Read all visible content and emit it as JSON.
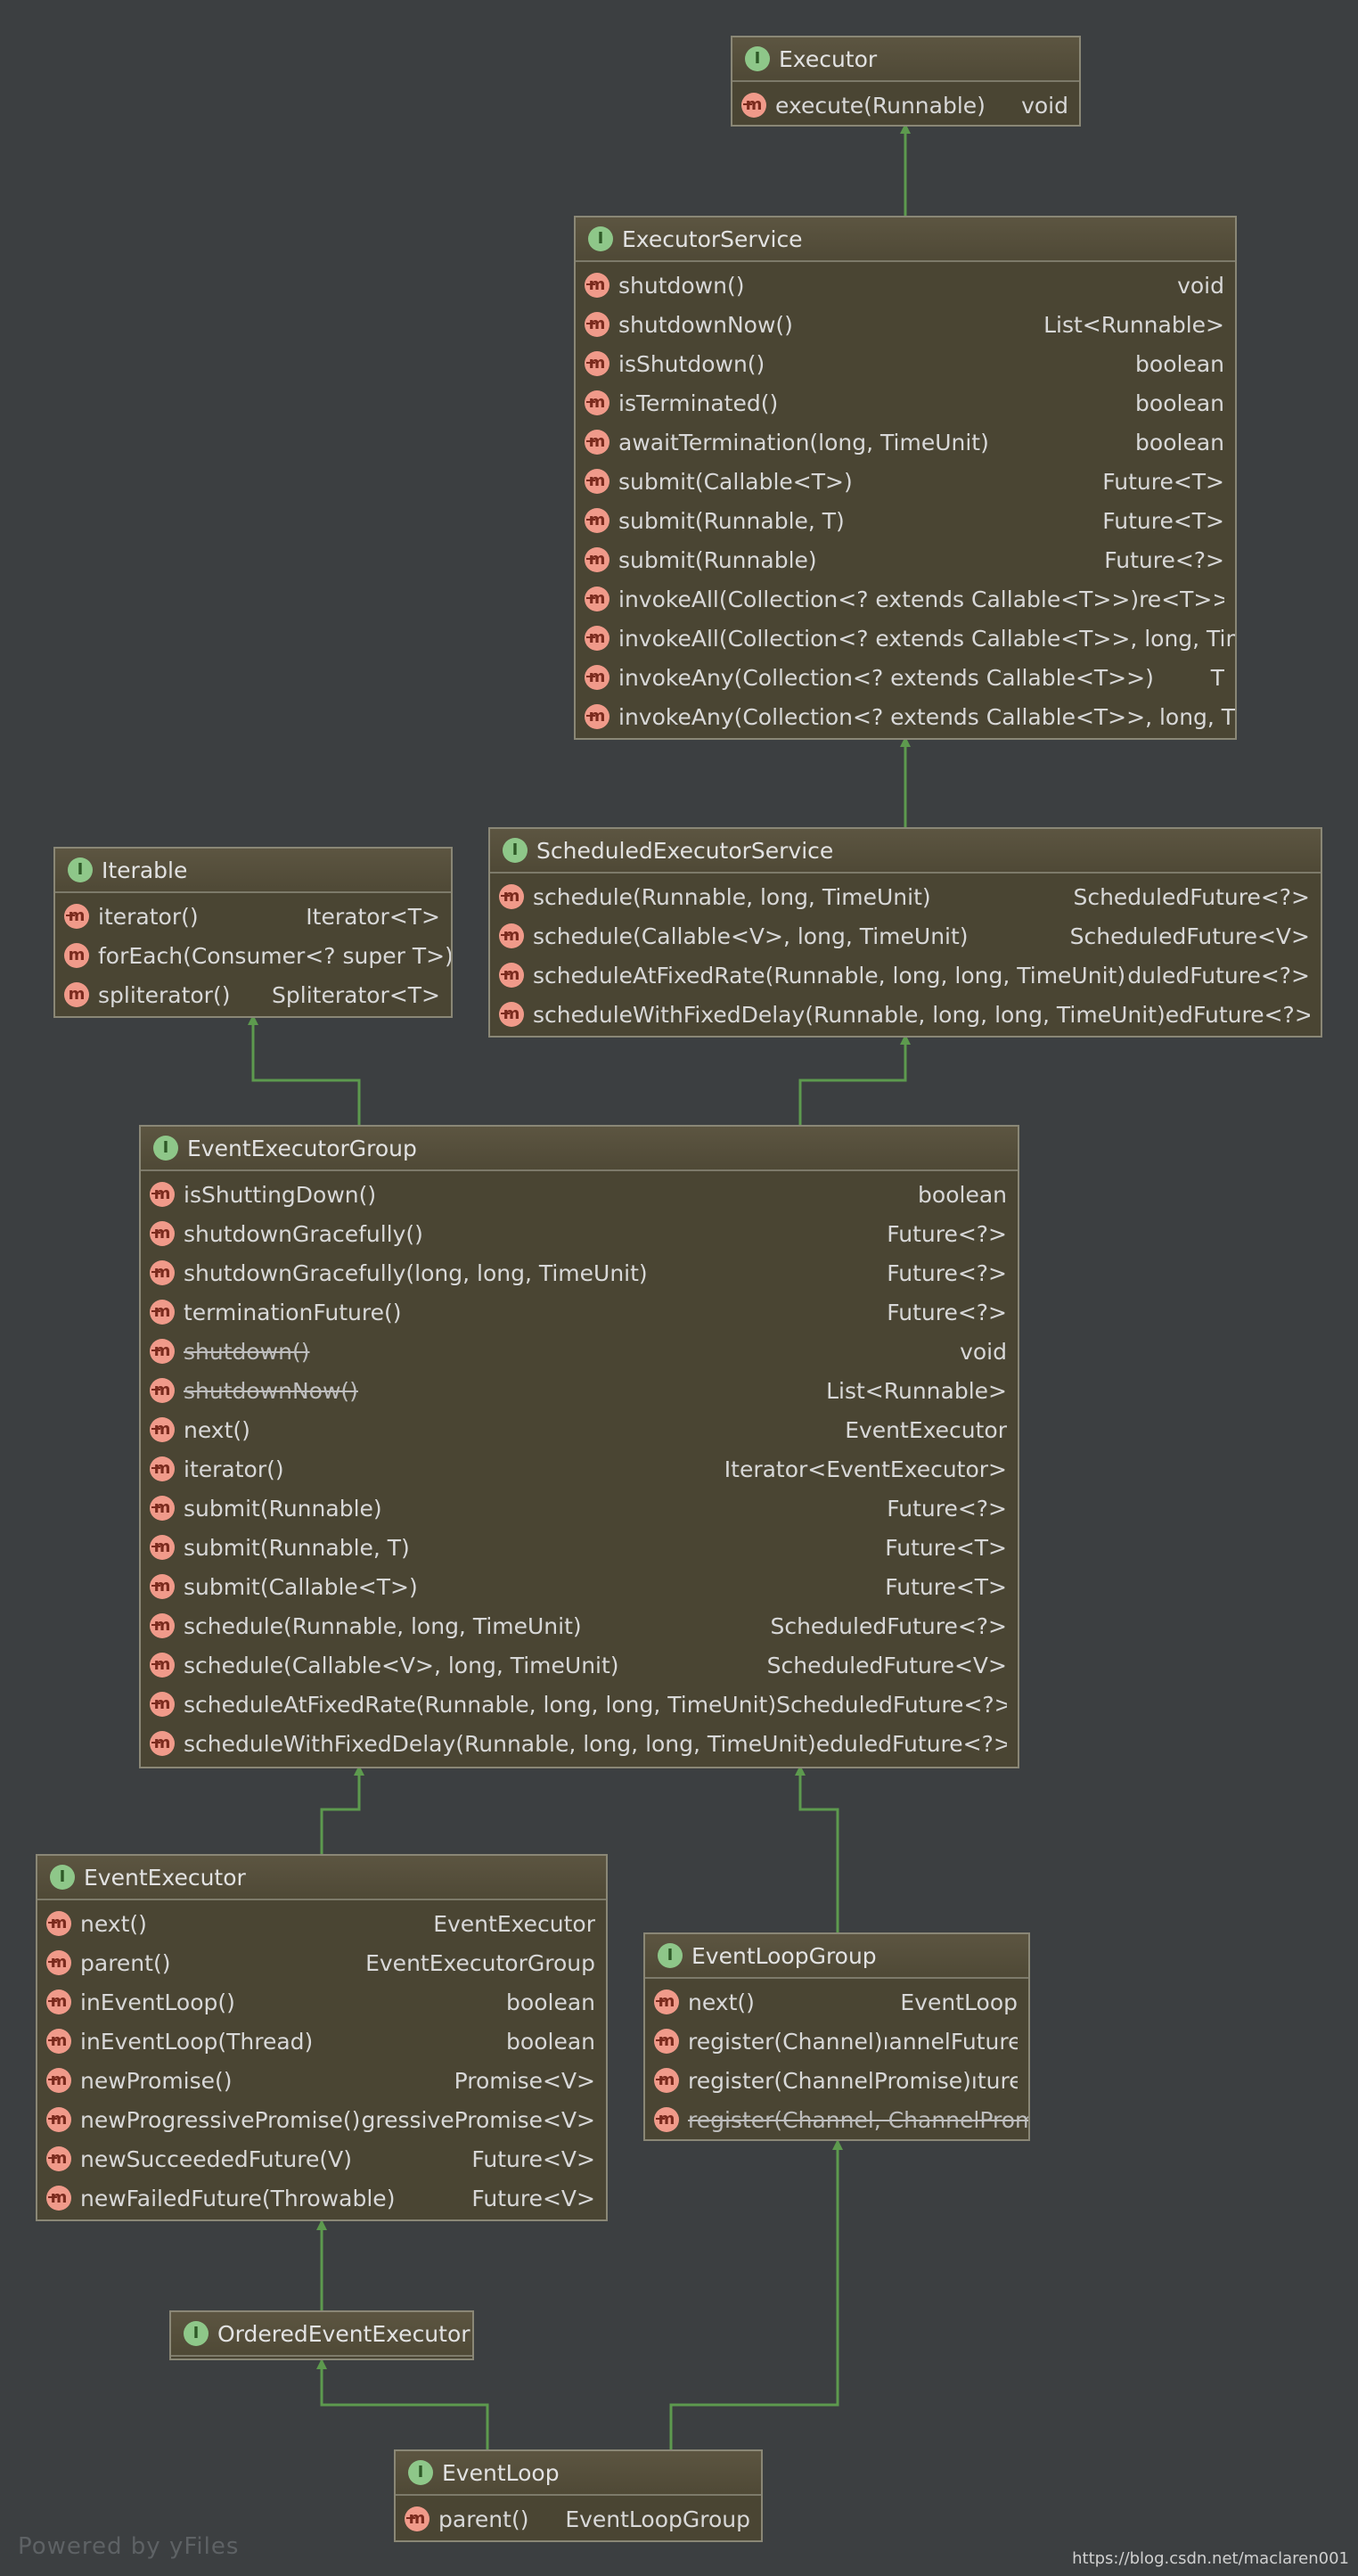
{
  "nodes": {
    "executor": {
      "title": "Executor",
      "methods": [
        {
          "name": "execute(Runnable)",
          "ret": "void",
          "abstract": true
        }
      ]
    },
    "executor_service": {
      "title": "ExecutorService",
      "methods": [
        {
          "name": "shutdown()",
          "ret": "void",
          "abstract": true
        },
        {
          "name": "shutdownNow()",
          "ret": "List<Runnable>",
          "abstract": true
        },
        {
          "name": "isShutdown()",
          "ret": "boolean",
          "abstract": true
        },
        {
          "name": "isTerminated()",
          "ret": "boolean",
          "abstract": true
        },
        {
          "name": "awaitTermination(long, TimeUnit)",
          "ret": "boolean",
          "abstract": true
        },
        {
          "name": "submit(Callable<T>)",
          "ret": "Future<T>",
          "abstract": true
        },
        {
          "name": "submit(Runnable, T)",
          "ret": "Future<T>",
          "abstract": true
        },
        {
          "name": "submit(Runnable)",
          "ret": "Future<?>",
          "abstract": true
        },
        {
          "name": "invokeAll(Collection<? extends Callable<T>>)",
          "ret": "re<T>>",
          "abstract": true
        },
        {
          "name": "invokeAll(Collection<? extends Callable<T>>, long, Tin",
          "ret": "",
          "abstract": true
        },
        {
          "name": "invokeAny(Collection<? extends Callable<T>>)",
          "ret": "T",
          "abstract": true
        },
        {
          "name": "invokeAny(Collection<? extends Callable<T>>, long, T",
          "ret": "",
          "abstract": true
        }
      ]
    },
    "scheduled_executor_service": {
      "title": "ScheduledExecutorService",
      "methods": [
        {
          "name": "schedule(Runnable, long, TimeUnit)",
          "ret": "ScheduledFuture<?>",
          "abstract": true
        },
        {
          "name": "schedule(Callable<V>, long, TimeUnit)",
          "ret": "ScheduledFuture<V>",
          "abstract": true
        },
        {
          "name": "scheduleAtFixedRate(Runnable, long, long, TimeUnit)",
          "ret": "duledFuture<?>",
          "abstract": true
        },
        {
          "name": "scheduleWithFixedDelay(Runnable, long, long, TimeUnit)",
          "ret": "edFuture<?>",
          "abstract": true
        }
      ]
    },
    "iterable": {
      "title": "Iterable",
      "methods": [
        {
          "name": "iterator()",
          "ret": "Iterator<T>",
          "abstract": true
        },
        {
          "name": "forEach(Consumer<? super T>)",
          "ret": "",
          "abstract": false
        },
        {
          "name": "spliterator()",
          "ret": "Spliterator<T>",
          "abstract": false
        }
      ]
    },
    "event_executor_group": {
      "title": "EventExecutorGroup",
      "methods": [
        {
          "name": "isShuttingDown()",
          "ret": "boolean",
          "abstract": true
        },
        {
          "name": "shutdownGracefully()",
          "ret": "Future<?>",
          "abstract": true
        },
        {
          "name": "shutdownGracefully(long, long, TimeUnit)",
          "ret": "Future<?>",
          "abstract": true
        },
        {
          "name": "terminationFuture()",
          "ret": "Future<?>",
          "abstract": true
        },
        {
          "name": "shutdown()",
          "ret": "void",
          "abstract": true,
          "deprecated": true
        },
        {
          "name": "shutdownNow()",
          "ret": "List<Runnable>",
          "abstract": true,
          "deprecated": true
        },
        {
          "name": "next()",
          "ret": "EventExecutor",
          "abstract": true
        },
        {
          "name": "iterator()",
          "ret": "Iterator<EventExecutor>",
          "abstract": true
        },
        {
          "name": "submit(Runnable)",
          "ret": "Future<?>",
          "abstract": true
        },
        {
          "name": "submit(Runnable, T)",
          "ret": "Future<T>",
          "abstract": true
        },
        {
          "name": "submit(Callable<T>)",
          "ret": "Future<T>",
          "abstract": true
        },
        {
          "name": "schedule(Runnable, long, TimeUnit)",
          "ret": "ScheduledFuture<?>",
          "abstract": true
        },
        {
          "name": "schedule(Callable<V>, long, TimeUnit)",
          "ret": "ScheduledFuture<V>",
          "abstract": true
        },
        {
          "name": "scheduleAtFixedRate(Runnable, long, long, TimeUnit)",
          "ret": "ScheduledFuture<?>",
          "abstract": true
        },
        {
          "name": "scheduleWithFixedDelay(Runnable, long, long, TimeUnit)",
          "ret": "eduledFuture<?>",
          "abstract": true
        }
      ]
    },
    "event_executor": {
      "title": "EventExecutor",
      "methods": [
        {
          "name": "next()",
          "ret": "EventExecutor",
          "abstract": true
        },
        {
          "name": "parent()",
          "ret": "EventExecutorGroup",
          "abstract": true
        },
        {
          "name": "inEventLoop()",
          "ret": "boolean",
          "abstract": true
        },
        {
          "name": "inEventLoop(Thread)",
          "ret": "boolean",
          "abstract": true
        },
        {
          "name": "newPromise()",
          "ret": "Promise<V>",
          "abstract": true
        },
        {
          "name": "newProgressivePromise()",
          "ret": "gressivePromise<V>",
          "abstract": true
        },
        {
          "name": "newSucceededFuture(V)",
          "ret": "Future<V>",
          "abstract": true
        },
        {
          "name": "newFailedFuture(Throwable)",
          "ret": "Future<V>",
          "abstract": true
        }
      ]
    },
    "event_loop_group": {
      "title": "EventLoopGroup",
      "methods": [
        {
          "name": "next()",
          "ret": "EventLoop",
          "abstract": true
        },
        {
          "name": "register(Channel)",
          "ret": "ıannelFuture",
          "abstract": true
        },
        {
          "name": "register(ChannelPromise)",
          "ret": "ıture",
          "abstract": true
        },
        {
          "name": "register(Channel, ChannelProm",
          "ret": "",
          "abstract": true,
          "deprecated": true
        }
      ]
    },
    "ordered_event_executor": {
      "title": "OrderedEventExecutor",
      "methods": []
    },
    "event_loop": {
      "title": "EventLoop",
      "methods": [
        {
          "name": "parent()",
          "ret": "EventLoopGroup",
          "abstract": true
        }
      ]
    }
  },
  "badges": {
    "interface": "I",
    "method": "m"
  },
  "colors": {
    "background": "#3c3f41",
    "node_fill": "#4a4533",
    "node_border": "#8a8776",
    "edge": "#5d9a4e",
    "interface_badge": "#8ec789",
    "method_badge": "#f09a8a"
  },
  "footer": {
    "watermark": "Powered by yFiles",
    "source": "https://blog.csdn.net/maclaren001"
  }
}
